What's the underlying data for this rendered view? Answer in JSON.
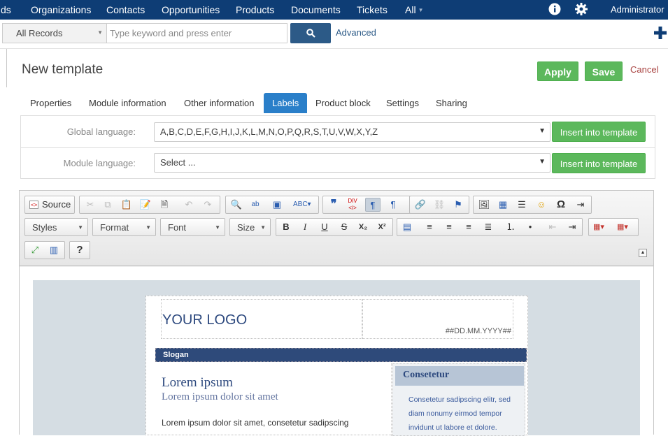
{
  "nav": {
    "items": [
      "ds",
      "Organizations",
      "Contacts",
      "Opportunities",
      "Products",
      "Documents",
      "Tickets",
      "All"
    ],
    "user": "Administrator",
    "info_icon": "info-icon",
    "settings_icon": "gear-icon",
    "bg_color": "#0e3d75"
  },
  "search": {
    "records_label": "All Records",
    "placeholder": "Type keyword and press enter",
    "search_icon": "search-icon",
    "advanced_label": "Advanced",
    "add_icon": "plus-icon"
  },
  "page": {
    "title": "New template",
    "apply_label": "Apply",
    "save_label": "Save",
    "cancel_label": "Cancel"
  },
  "tabs": [
    "Properties",
    "Module information",
    "Other information",
    "Labels",
    "Product block",
    "Settings",
    "Sharing"
  ],
  "active_tab": "Labels",
  "labels_panel": {
    "global_label": "Global language:",
    "global_value": "A,B,C,D,E,F,G,H,I,J,K,L,M,N,O,P,Q,R,S,T,U,V,W,X,Y,Z",
    "module_label": "Module language:",
    "module_value": "Select ...",
    "insert_label": "Insert into template"
  },
  "editor": {
    "source_label": "Source",
    "styles_label": "Styles",
    "format_label": "Format",
    "font_label": "Font",
    "size_label": "Size",
    "help_label": "?"
  },
  "template": {
    "logo": "YOUR LOGO",
    "date": "##DD.MM.YYYY##",
    "slogan": "Slogan",
    "heading": "Lorem ipsum",
    "subheading": "Lorem ipsum dolor sit amet",
    "paragraph": "Lorem ipsum dolor sit amet, consetetur sadipscing",
    "side_heading": "Consetetur",
    "side_text": "Consetetur sadipscing elitr, sed diam nonumy eirmod tempor invidunt ut labore et dolore."
  }
}
